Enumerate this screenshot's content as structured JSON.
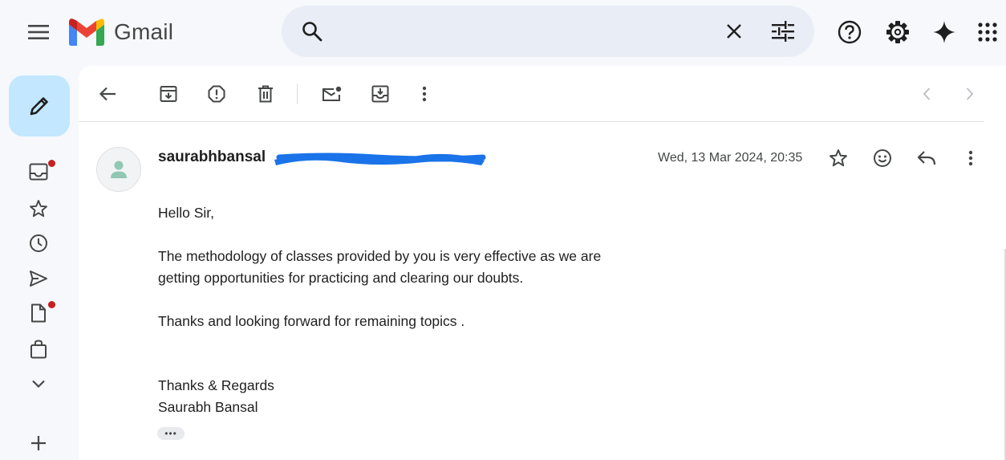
{
  "app": {
    "name": "Gmail"
  },
  "search": {
    "placeholder": "",
    "value": ""
  },
  "email": {
    "sender_name": "saurabhbansal",
    "date": "Wed, 13 Mar 2024, 20:35",
    "body": {
      "greeting": "Hello Sir,",
      "para1_line1": "The methodology of classes provided by you is very effective as we are",
      "para1_line2": "getting opportunities for practicing and clearing our doubts.",
      "para2": "Thanks and looking forward for remaining topics .",
      "signoff": "Thanks & Regards",
      "signature": "Saurabh Bansal"
    },
    "show_trimmed": "•••"
  },
  "rail": {
    "inbox_has_dot": true,
    "drafts_has_dot": true
  },
  "colors": {
    "compose_bg": "#c2e7ff",
    "search_bg": "#e9eef6",
    "redaction": "#1a73e8",
    "notification_dot": "#c5221f",
    "page_bg": "#f6f8fc"
  },
  "icons": {
    "header": [
      "menu-icon",
      "search-icon",
      "clear-icon",
      "tune-icon",
      "help-icon",
      "settings-icon",
      "gemini-sparkle-icon",
      "apps-grid-icon"
    ],
    "rail": [
      "pencil-icon",
      "inbox-icon",
      "star-icon",
      "clock-icon",
      "send-icon",
      "draft-icon",
      "bag-icon",
      "chevron-down-icon",
      "plus-icon"
    ],
    "toolbar": [
      "back-arrow-icon",
      "archive-icon",
      "report-spam-icon",
      "trash-icon",
      "mark-unread-icon",
      "move-to-icon",
      "more-vert-icon",
      "chevron-left-icon",
      "chevron-right-icon"
    ],
    "message": [
      "person-icon",
      "star-outline-icon",
      "emoji-icon",
      "reply-icon",
      "more-vert-icon"
    ]
  }
}
